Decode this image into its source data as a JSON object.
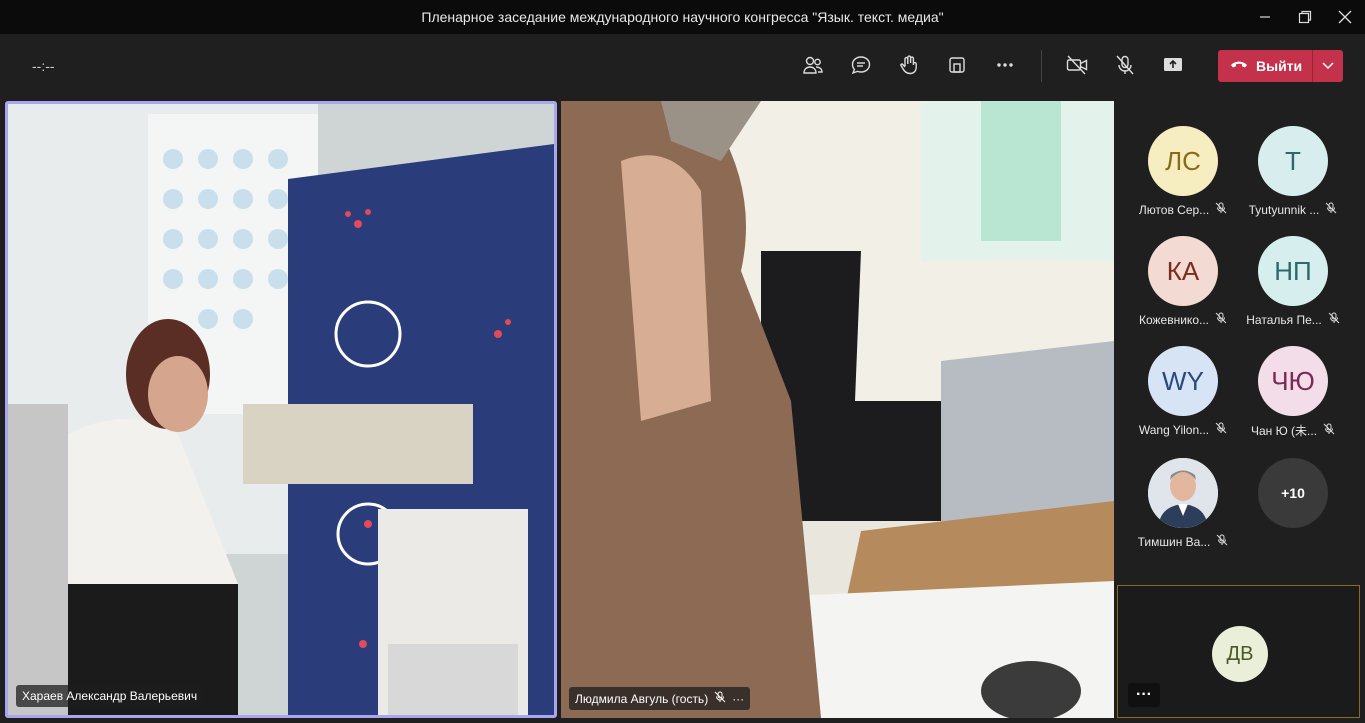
{
  "window": {
    "title": "Пленарное заседание международного научного конгресса \"Язык. текст. медиа\""
  },
  "toolbar": {
    "timer": "--:--",
    "leave_label": "Выйти"
  },
  "tiles": [
    {
      "name": "Хараев Александр Валерьевич"
    },
    {
      "name": "Людмила Авгуль (гость)",
      "more": "···"
    }
  ],
  "participants": [
    {
      "initials": "ЛС",
      "name": "Лютов Сер...",
      "bg": "#f6eec1",
      "fg": "#8a6a1a"
    },
    {
      "initials": "Т",
      "name": "Tyutyunnik ...",
      "bg": "#d8eeee",
      "fg": "#2a6a6a"
    },
    {
      "initials": "КА",
      "name": "Кожевнико...",
      "bg": "#f3dad3",
      "fg": "#7a2d1f"
    },
    {
      "initials": "НП",
      "name": "Наталья Пе...",
      "bg": "#d7eeee",
      "fg": "#2a6a6a"
    },
    {
      "initials": "WY",
      "name": "Wang Yilon...",
      "bg": "#d6e4f6",
      "fg": "#2a4a7a"
    },
    {
      "initials": "ЧЮ",
      "name": "Чан Ю (未...",
      "bg": "#f3dde8",
      "fg": "#7a2a55"
    },
    {
      "initials": "",
      "name": "Тимшин Ва...",
      "bg": "#b9c6d3",
      "fg": "#333"
    },
    {
      "initials": "+10",
      "name": "",
      "bg": "#3a3a3a",
      "fg": "#ffffff"
    }
  ],
  "self": {
    "initials": "ДВ",
    "more": "···"
  }
}
